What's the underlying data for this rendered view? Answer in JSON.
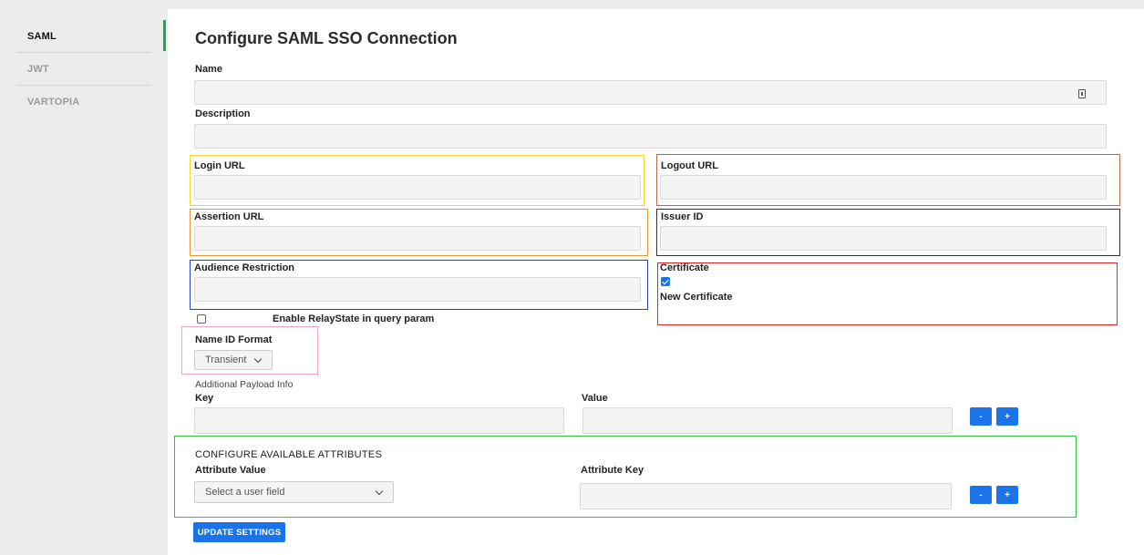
{
  "sidebar": {
    "items": [
      {
        "label": "SAML"
      },
      {
        "label": "JWT"
      },
      {
        "label": "VARTOPIA"
      }
    ]
  },
  "form": {
    "title": "Configure SAML SSO Connection",
    "name_label": "Name",
    "description_label": "Description",
    "login_url_label": "Login URL",
    "logout_url_label": "Logout URL",
    "assertion_url_label": "Assertion URL",
    "issuer_id_label": "Issuer ID",
    "audience_restriction_label": "Audience Restriction",
    "certificate_label": "Certificate",
    "new_certificate_label": "New Certificate",
    "relaystate_label": "Enable RelayState in query param",
    "name_id_format_label": "Name ID Format",
    "name_id_format_value": "Transient",
    "additional_payload_label": "Additional Payload Info",
    "key_label": "Key",
    "value_label": "Value",
    "minus_label": "-",
    "plus_label": "+",
    "attributes_heading": "CONFIGURE AVAILABLE ATTRIBUTES",
    "attribute_value_label": "Attribute Value",
    "attribute_value_placeholder": "Select a user field",
    "attribute_key_label": "Attribute Key",
    "update_button": "UPDATE SETTINGS"
  },
  "colors": {
    "accent_blue": "#1a73e8",
    "active_green": "#1fa84f"
  }
}
